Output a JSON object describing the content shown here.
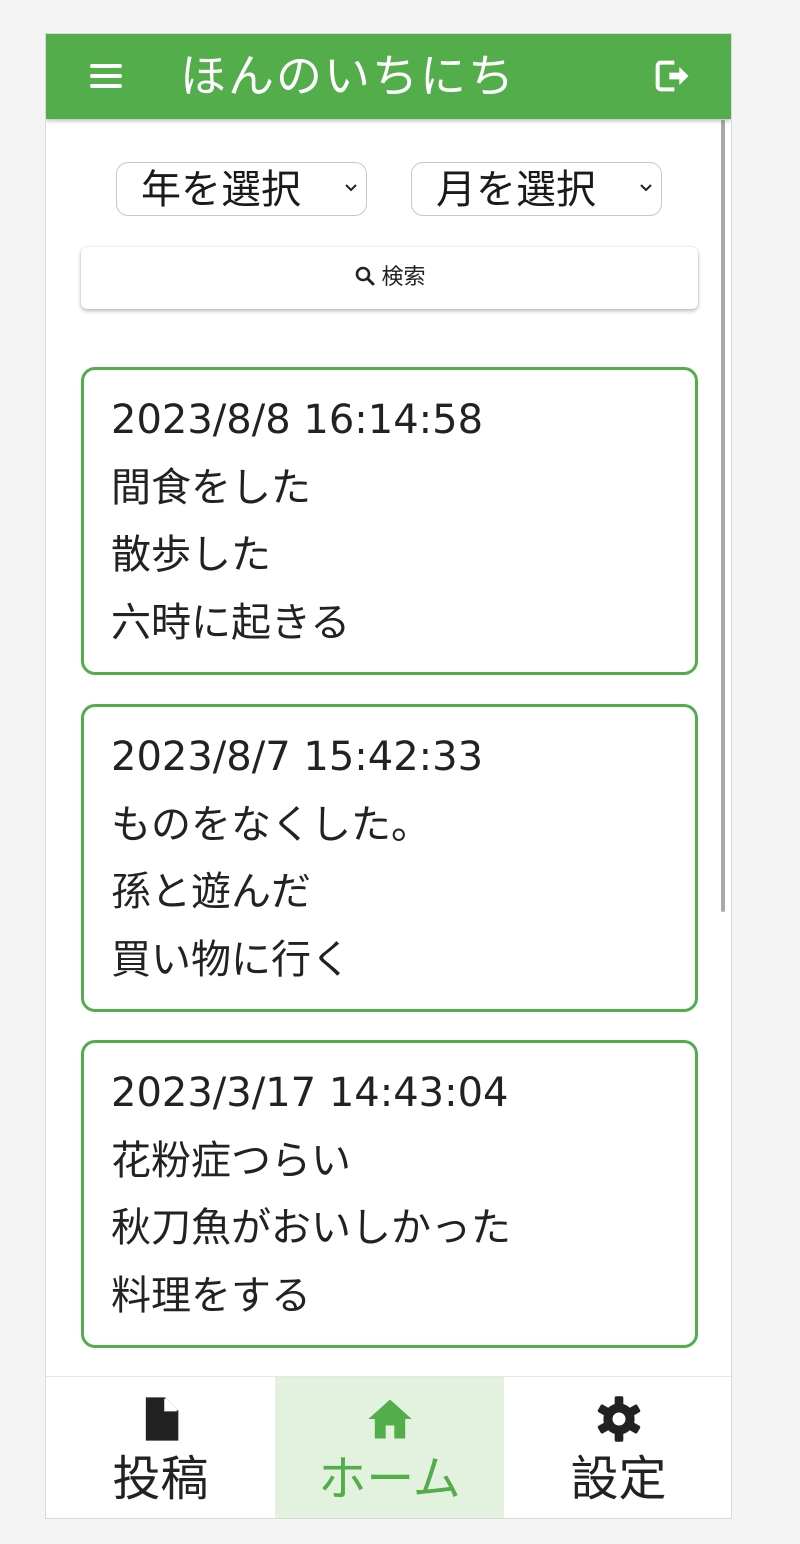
{
  "app": {
    "title": "ほんのいちにち"
  },
  "filters": {
    "year_label": "年を選択",
    "month_label": "月を選択",
    "search_label": "検索"
  },
  "entries": [
    {
      "timestamp": "2023/8/8 16:14:58",
      "lines": [
        "間食をした",
        "散歩した",
        "六時に起きる"
      ]
    },
    {
      "timestamp": "2023/8/7 15:42:33",
      "lines": [
        "ものをなくした。",
        "孫と遊んだ",
        "買い物に行く"
      ]
    },
    {
      "timestamp": "2023/3/17 14:43:04",
      "lines": [
        "花粉症つらい",
        "秋刀魚がおいしかった",
        "料理をする"
      ]
    }
  ],
  "bottom_nav": {
    "items": [
      {
        "label": "投稿",
        "icon": "document-icon"
      },
      {
        "label": "ホーム",
        "icon": "home-icon",
        "active": true
      },
      {
        "label": "設定",
        "icon": "gear-icon"
      }
    ]
  },
  "colors": {
    "brand": "#52ad4a",
    "active_bg": "#e3f2df"
  }
}
